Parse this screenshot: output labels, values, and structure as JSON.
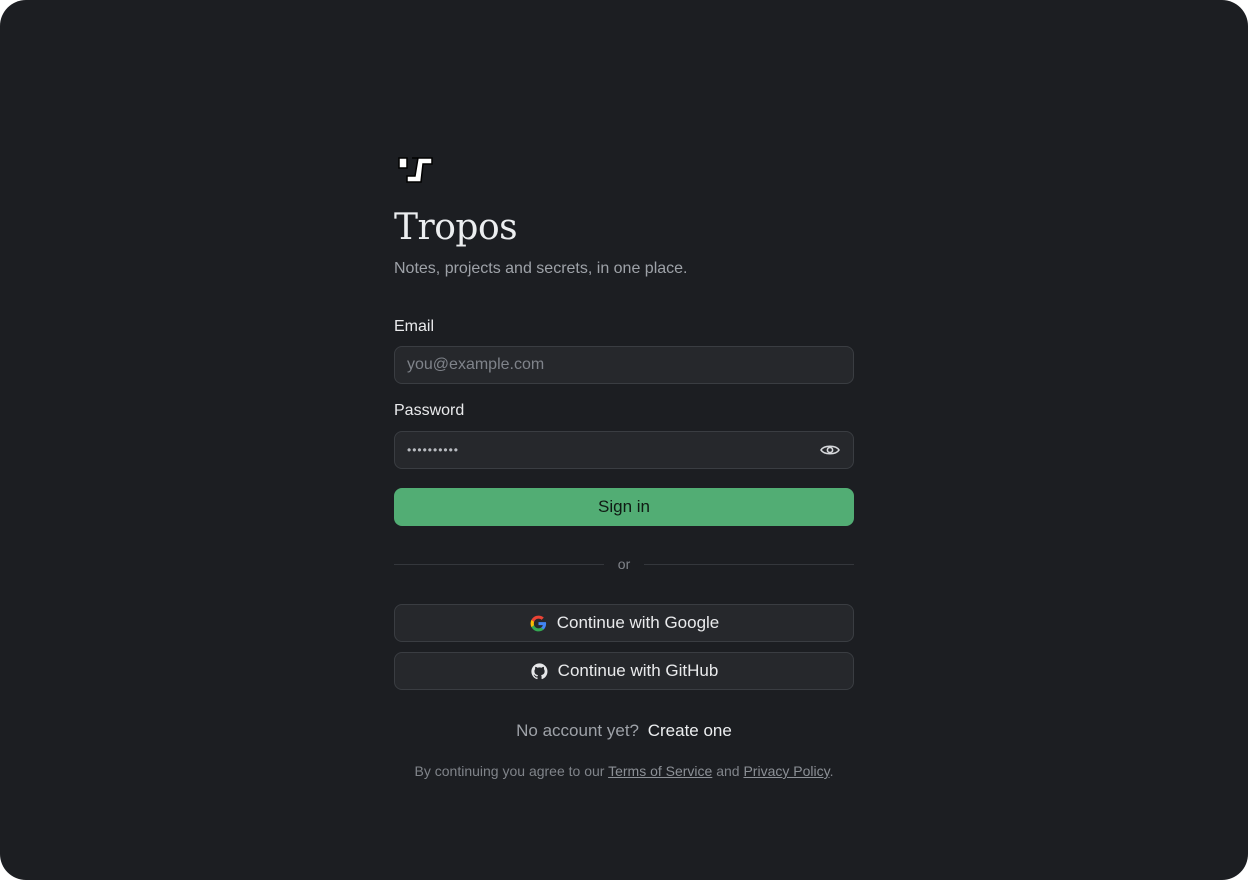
{
  "app": {
    "name": "Tropos",
    "tagline": "Notes, projects and secrets, in one place."
  },
  "form": {
    "email_label": "Email",
    "email_placeholder": "you@example.com",
    "email_value": "",
    "password_label": "Password",
    "password_value": "••••••••••",
    "show_password_icon": "eye-icon",
    "submit_label": "Sign in"
  },
  "divider": {
    "text": "or"
  },
  "oauth": {
    "google_label": "Continue with Google",
    "google_icon": "google-icon",
    "github_label": "Continue with GitHub",
    "github_icon": "github-icon"
  },
  "signup": {
    "prompt": "No account yet?",
    "link": "Create one"
  },
  "legal": {
    "prefix": "By continuing you agree to our",
    "terms": "Terms of Service",
    "and": "and",
    "privacy": "Privacy Policy",
    "suffix": "."
  },
  "colors": {
    "background": "#1c1e22",
    "input_bg": "#26282c",
    "accent_green": "#52ad74"
  }
}
